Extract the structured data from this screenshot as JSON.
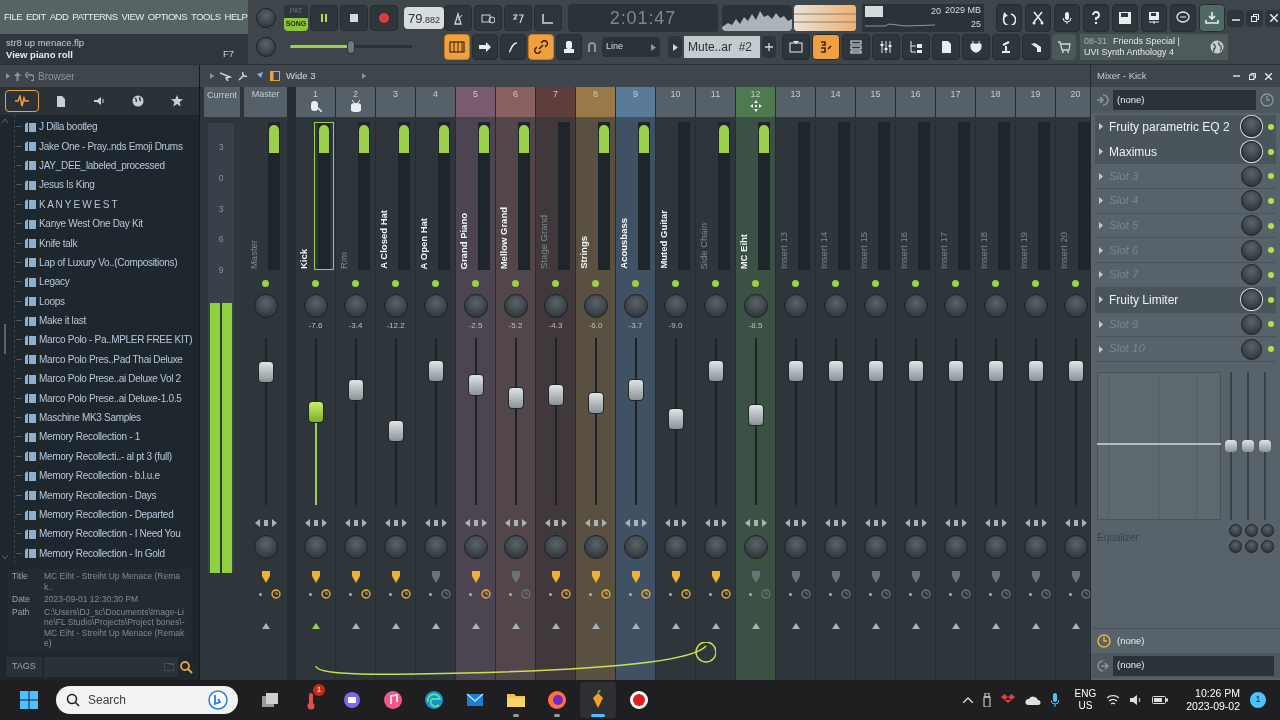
{
  "menu": [
    "FILE",
    "EDIT",
    "ADD",
    "PATTERNS",
    "VIEW",
    "OPTIONS",
    "TOOLS",
    "HELP"
  ],
  "hint": {
    "file": "str8 up menace.flp",
    "text": "View piano roll",
    "key": "F7"
  },
  "transport": {
    "modes": [
      {
        "label": "PAT",
        "selected": false
      },
      {
        "label": "SONG",
        "selected": true
      }
    ],
    "playing": true,
    "tempo": "79",
    "tempo_fraction": ".882",
    "master_volume": {
      "level": 0.5
    }
  },
  "timer": "2:01:47",
  "monitor": {
    "poly": "20",
    "memory": "2029 MB",
    "cpu": "25"
  },
  "snap": "Line",
  "pattern": "Mute..ar  #2",
  "news": {
    "date": "08-31",
    "title": "Friends Special |",
    "subtitle": "UVI Synth Anthology 4"
  },
  "browser": {
    "title": "Browser",
    "tabs": [
      {
        "kind": "all",
        "selected": true
      },
      {
        "kind": "files",
        "selected": false
      },
      {
        "kind": "sounds",
        "selected": false
      },
      {
        "kind": "web",
        "selected": false
      },
      {
        "kind": "favorites",
        "selected": false
      }
    ],
    "items": [
      "J Dilla bootleg",
      "Jake One - Pray..nds Emoji Drums",
      "JAY_DEE_labeled_processed",
      "Jesus Is King",
      "K A N Y E W E S T",
      "Kanye West One Day Kit",
      "Knife talk",
      "Lap of Luxury Vo..(Compositions)",
      "Legacy",
      "Loops",
      "Make it last",
      "Marco Polo - Pa..MPLER FREE KIT)",
      "Marco Polo Pres..Pad Thai Deluxe",
      "Marco Polo Prese..ai Deluxe Vol 2",
      "Marco Polo Prese..ai Deluxe-1.0.5",
      "Maschine MK3 Samples",
      "Memory Recollection - 1",
      "Memory Recollecti..- al pt 3 (full)",
      "Memory Recollection - b.l.u.e",
      "Memory Recollection - Days",
      "Memory Recollection - Departed",
      "Memory Recollection - I Need You",
      "Memory Recollection - In Gold"
    ],
    "info": [
      {
        "label": "Title",
        "value": "MC Eiht - Streiht Up Menace (Remak.."
      },
      {
        "label": "Date",
        "value": "2023-09-01 12:30:30 PM"
      },
      {
        "label": "Path",
        "value": "C:\\Users\\DJ_sc\\Documents\\Image-Line\\FL Studio\\Projects\\Project bones\\-MC Eiht - Streiht Up Menace (Remake)"
      }
    ],
    "tags_label": "TAGS"
  },
  "mixer": {
    "preset": "Wide 3",
    "current_label": "Current",
    "scale": [
      "3",
      "0",
      "3",
      "6",
      "9"
    ],
    "current_meter": {
      "level": 0.6
    },
    "master": {
      "label": "Master",
      "name": "Master",
      "active": false,
      "selected": false,
      "level": 0.83,
      "peak": true,
      "send": true
    },
    "tracks": [
      {
        "number": "1",
        "name": "Kick",
        "active": true,
        "selected": true,
        "volume": "-7.6",
        "level": 0.58,
        "peak": true,
        "send": true
      },
      {
        "number": "2",
        "name": "Rim",
        "active": false,
        "selected": false,
        "volume": "-3.4",
        "level": 0.72,
        "peak": true,
        "send": true
      },
      {
        "number": "3",
        "name": "A Closed Hat",
        "active": true,
        "selected": false,
        "volume": "-12.2",
        "level": 0.46,
        "peak": true,
        "send": true
      },
      {
        "number": "4",
        "name": "A Open Hat",
        "active": true,
        "selected": false,
        "level": 0.84,
        "peak": true,
        "send": false
      },
      {
        "number": "5",
        "name": "Grand Piano",
        "active": true,
        "selected": false,
        "volume": "-2.5",
        "level": 0.75,
        "peak": true,
        "send": true,
        "color": "#7a5a6e"
      },
      {
        "number": "6",
        "name": "Mellow Grand",
        "active": true,
        "selected": false,
        "volume": "-5.2",
        "level": 0.67,
        "peak": true,
        "send": false,
        "color": "#8a5f5f"
      },
      {
        "number": "7",
        "name": "Stage Grand",
        "active": false,
        "selected": false,
        "volume": "-4.3",
        "level": 0.69,
        "peak": false,
        "send": true,
        "color": "#5e3d3d"
      },
      {
        "number": "8",
        "name": "Strings",
        "active": true,
        "selected": false,
        "volume": "-6.0",
        "level": 0.64,
        "peak": true,
        "send": true,
        "color": "#9a7848"
      },
      {
        "number": "9",
        "name": "Acousbass",
        "active": true,
        "selected": false,
        "volume": "-3.7",
        "level": 0.72,
        "peak": true,
        "send": true,
        "color": "#5a7a9a"
      },
      {
        "number": "10",
        "name": "Muted Guitar",
        "active": true,
        "selected": false,
        "volume": "-9.0",
        "level": 0.54,
        "peak": false,
        "send": true
      },
      {
        "number": "11",
        "name": "Side Chain",
        "active": false,
        "selected": false,
        "level": 0.84,
        "peak": true,
        "send": true
      },
      {
        "number": "12",
        "name": "MC Eiht",
        "active": true,
        "selected": false,
        "volume": "-8.5",
        "level": 0.56,
        "peak": true,
        "send": false,
        "color": "#4f7a4f"
      },
      {
        "number": "13",
        "name": "Insert 13",
        "active": false,
        "selected": false,
        "level": 0.84,
        "peak": false,
        "send": false
      },
      {
        "number": "14",
        "name": "Insert 14",
        "active": false,
        "selected": false,
        "level": 0.84,
        "peak": false,
        "send": false
      },
      {
        "number": "15",
        "name": "Insert 15",
        "active": false,
        "selected": false,
        "level": 0.84,
        "peak": false,
        "send": false
      },
      {
        "number": "16",
        "name": "Insert 16",
        "active": false,
        "selected": false,
        "level": 0.84,
        "peak": false,
        "send": false
      },
      {
        "number": "17",
        "name": "Insert 17",
        "active": false,
        "selected": false,
        "level": 0.84,
        "peak": false,
        "send": false
      },
      {
        "number": "18",
        "name": "Insert 18",
        "active": false,
        "selected": false,
        "level": 0.84,
        "peak": false,
        "send": false
      },
      {
        "number": "19",
        "name": "Insert 19",
        "active": false,
        "selected": false,
        "level": 0.84,
        "peak": false,
        "send": false
      },
      {
        "number": "20",
        "name": "Insert 20",
        "active": false,
        "selected": false,
        "level": 0.84,
        "peak": false,
        "send": false
      }
    ]
  },
  "mixer_panel": {
    "title": "Mixer - Kick",
    "input": "(none)",
    "slots": [
      {
        "name": "Fruity parametric EQ 2",
        "kind": "plugin"
      },
      {
        "name": "Maximus",
        "kind": "plugin"
      },
      {
        "name": "Slot 3",
        "kind": "empty"
      },
      {
        "name": "Slot 4",
        "kind": "empty"
      },
      {
        "name": "Slot 5",
        "kind": "empty"
      },
      {
        "name": "Slot 6",
        "kind": "empty"
      },
      {
        "name": "Slot 7",
        "kind": "empty"
      },
      {
        "name": "Fruity Limiter",
        "kind": "plugin"
      },
      {
        "name": "Slot 9",
        "kind": "empty"
      },
      {
        "name": "Slot 10",
        "kind": "empty"
      }
    ],
    "eq_label": "Equalizer",
    "eq_bands": [
      {
        "level": 0.5
      },
      {
        "level": 0.5
      },
      {
        "level": 0.5
      }
    ],
    "send": "(none)",
    "output": "(none)"
  },
  "taskbar": {
    "search": "Search",
    "apps": [
      {
        "kind": "taskview",
        "running": false
      },
      {
        "kind": "thermometer",
        "running": false,
        "badge": "1"
      },
      {
        "kind": "chat",
        "running": false
      },
      {
        "kind": "music",
        "running": false
      },
      {
        "kind": "edge",
        "running": false
      },
      {
        "kind": "mail",
        "running": false
      },
      {
        "kind": "folder",
        "running": true
      },
      {
        "kind": "firefox",
        "running": true
      },
      {
        "kind": "fl",
        "running": true,
        "active": true
      },
      {
        "kind": "recorder",
        "running": false
      }
    ],
    "lang": "ENG",
    "region": "US",
    "time": "10:26 PM",
    "date": "2023-09-02",
    "notifications": "1"
  }
}
